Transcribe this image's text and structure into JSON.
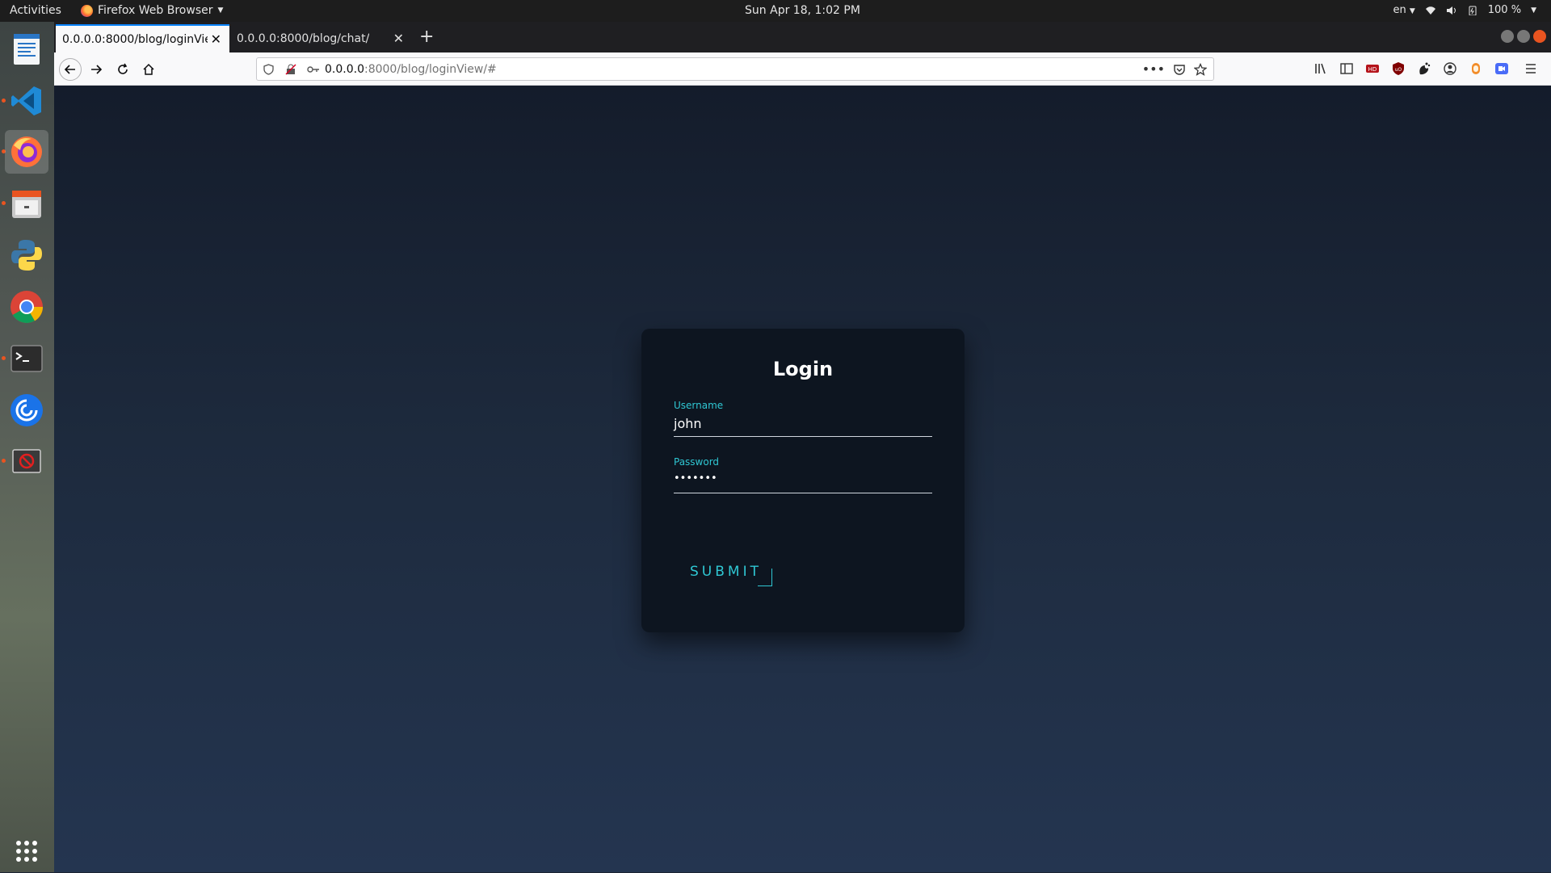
{
  "topbar": {
    "activities": "Activities",
    "app_name": "Firefox Web Browser",
    "clock": "Sun Apr 18,  1:02 PM",
    "language": "en",
    "battery": "100 %"
  },
  "dock": {
    "items": [
      {
        "name": "libreoffice-writer",
        "running": false
      },
      {
        "name": "vscode",
        "running": true
      },
      {
        "name": "firefox",
        "running": true,
        "active": true
      },
      {
        "name": "files",
        "running": true
      },
      {
        "name": "python",
        "running": false
      },
      {
        "name": "chrome",
        "running": false
      },
      {
        "name": "terminal",
        "running": true
      },
      {
        "name": "app-circle",
        "running": false
      },
      {
        "name": "blocked-app",
        "running": true
      }
    ]
  },
  "browser": {
    "tabs": [
      {
        "title": "0.0.0.0:8000/blog/loginView/#",
        "selected": true
      },
      {
        "title": "0.0.0.0:8000/blog/chat/",
        "selected": false
      }
    ],
    "url_host": "0.0.0.0",
    "url_path": ":8000/blog/loginView/#"
  },
  "login": {
    "title": "Login",
    "username_label": "Username",
    "username_value": "john",
    "password_label": "Password",
    "password_value": "•••••••",
    "submit_label": "SUBMIT"
  },
  "colors": {
    "accent": "#2fc7d3",
    "card": "#0d1520",
    "page_top": "#141c2b",
    "page_bottom": "#243550"
  }
}
